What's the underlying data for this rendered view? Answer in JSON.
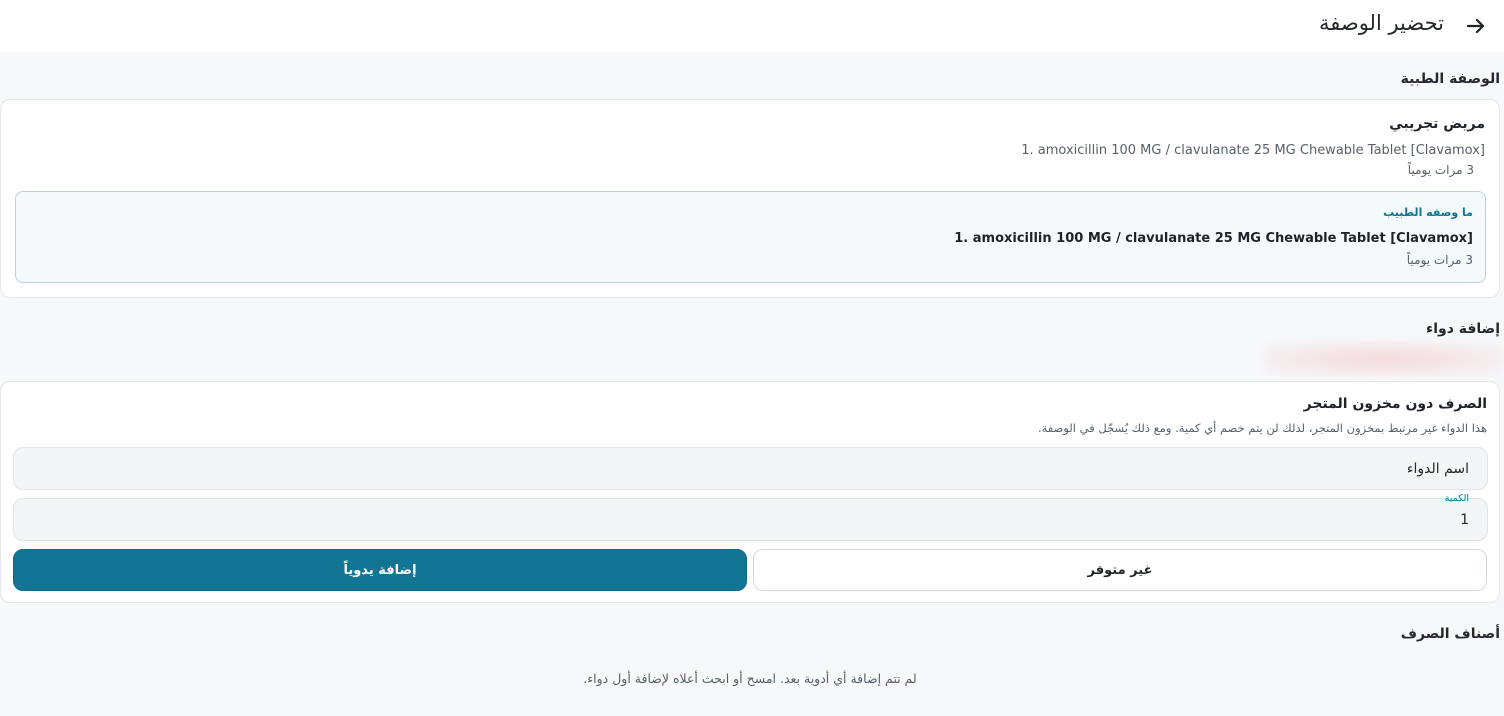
{
  "header": {
    "title": "تحضير الوصفة",
    "back_icon": "arrow-right-icon"
  },
  "prescription": {
    "section_title": "الوصفة الطبية",
    "patient_name": "مريض تجريبي",
    "medication_line": "1. amoxicillin 100 MG / clavulanate 25 MG Chewable Tablet [Clavamox]",
    "frequency": "3 مرات يومياً",
    "doctor_box": {
      "label": "ما وصفه الطبيب",
      "medication": "1. amoxicillin 100 MG / clavulanate 25 MG Chewable Tablet [Clavamox]",
      "frequency": "3 مرات يومياً"
    }
  },
  "add_drug": {
    "section_title": "إضافة دواء",
    "card_title": "الصرف دون مخزون المتجر",
    "card_description": "هذا الدواء غير مرتبط بمخزون المتجر، لذلك لن يتم خصم أي كمية. ومع ذلك يُسجّل في الوصفة.",
    "name_placeholder": "اسم الدواء",
    "quantity_label": "الكمية",
    "quantity_value": "1",
    "unavailable_label": "غير متوفر",
    "add_manual_label": "إضافة يدوياً"
  },
  "dispense_items": {
    "section_title": "أصناف الصرف",
    "empty_text": "لم تتم إضافة أي أدوية بعد. امسح أو ابحث أعلاه لإضافة أول دواء."
  },
  "colors": {
    "accent": "#117593",
    "accent_text": "#0e7490",
    "background": "#f6f8fa"
  }
}
